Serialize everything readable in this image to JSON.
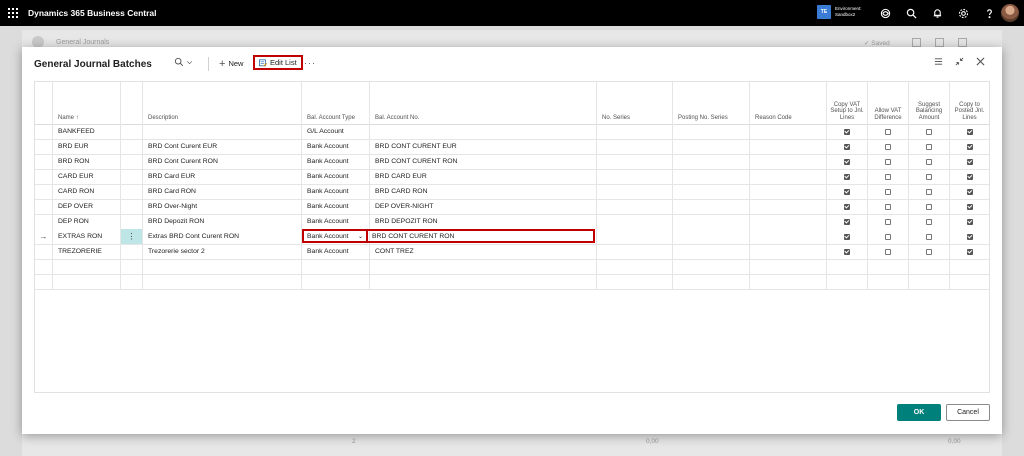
{
  "app": {
    "title": "Dynamics 365 Business Central",
    "env_badge": "TE",
    "env_label": "Environment:",
    "env_name": "Sandbox2"
  },
  "background": {
    "title": "General Journals",
    "saved": "✓ Saved",
    "foot_values": [
      "2",
      "0,00",
      "0,00"
    ]
  },
  "dialog": {
    "title": "General Journal Batches",
    "new_label": "New",
    "edit_list_label": "Edit List",
    "ok_label": "OK",
    "cancel_label": "Cancel"
  },
  "grid": {
    "columns": [
      {
        "key": "name",
        "label": "Name ↑"
      },
      {
        "key": "description",
        "label": "Description"
      },
      {
        "key": "bal_account_type",
        "label": "Bal. Account Type"
      },
      {
        "key": "bal_account_no",
        "label": "Bal. Account No."
      },
      {
        "key": "no_series",
        "label": "No. Series"
      },
      {
        "key": "posting_no_series",
        "label": "Posting No. Series"
      },
      {
        "key": "reason_code",
        "label": "Reason Code"
      },
      {
        "key": "copy_vat",
        "label": "Copy VAT Setup to Jnl. Lines"
      },
      {
        "key": "allow_vat",
        "label": "Allow VAT Difference"
      },
      {
        "key": "suggest_bal",
        "label": "Suggest Balancing Amount"
      },
      {
        "key": "copy_posted",
        "label": "Copy to Posted Jnl. Lines"
      }
    ],
    "rows": [
      {
        "name": "BANKFEED",
        "description": "",
        "bal_account_type": "G/L Account",
        "bal_account_no": "",
        "copy_vat": true,
        "allow_vat": false,
        "suggest_bal": false,
        "copy_posted": true
      },
      {
        "name": "BRD EUR",
        "description": "BRD Cont Curent EUR",
        "bal_account_type": "Bank Account",
        "bal_account_no": "BRD CONT CURENT EUR",
        "copy_vat": true,
        "allow_vat": false,
        "suggest_bal": false,
        "copy_posted": true
      },
      {
        "name": "BRD RON",
        "description": "BRD Cont Curent RON",
        "bal_account_type": "Bank Account",
        "bal_account_no": "BRD CONT CURENT RON",
        "copy_vat": true,
        "allow_vat": false,
        "suggest_bal": false,
        "copy_posted": true
      },
      {
        "name": "CARD EUR",
        "description": "BRD Card EUR",
        "bal_account_type": "Bank Account",
        "bal_account_no": "BRD CARD EUR",
        "copy_vat": true,
        "allow_vat": false,
        "suggest_bal": false,
        "copy_posted": true
      },
      {
        "name": "CARD RON",
        "description": "BRD Card RON",
        "bal_account_type": "Bank Account",
        "bal_account_no": "BRD CARD RON",
        "copy_vat": true,
        "allow_vat": false,
        "suggest_bal": false,
        "copy_posted": true
      },
      {
        "name": "DEP OVER",
        "description": "BRD Over-Night",
        "bal_account_type": "Bank Account",
        "bal_account_no": "DEP OVER-NIGHT",
        "copy_vat": true,
        "allow_vat": false,
        "suggest_bal": false,
        "copy_posted": true
      },
      {
        "name": "DEP RON",
        "description": "BRD Depozit RON",
        "bal_account_type": "Bank Account",
        "bal_account_no": "BRD DEPOZIT RON",
        "copy_vat": true,
        "allow_vat": false,
        "suggest_bal": false,
        "copy_posted": true
      },
      {
        "name": "EXTRAS RON",
        "description": "Extras BRD Cont Curent RON",
        "bal_account_type": "Bank Account",
        "bal_account_no": "BRD CONT CURENT RON",
        "copy_vat": true,
        "allow_vat": false,
        "suggest_bal": false,
        "copy_posted": true
      },
      {
        "name": "TREZORERIE",
        "description": "Trezorerie sector 2",
        "bal_account_type": "Bank Account",
        "bal_account_no": "CONT TREZ",
        "copy_vat": true,
        "allow_vat": false,
        "suggest_bal": false,
        "copy_posted": true
      }
    ],
    "active_row": 7
  }
}
